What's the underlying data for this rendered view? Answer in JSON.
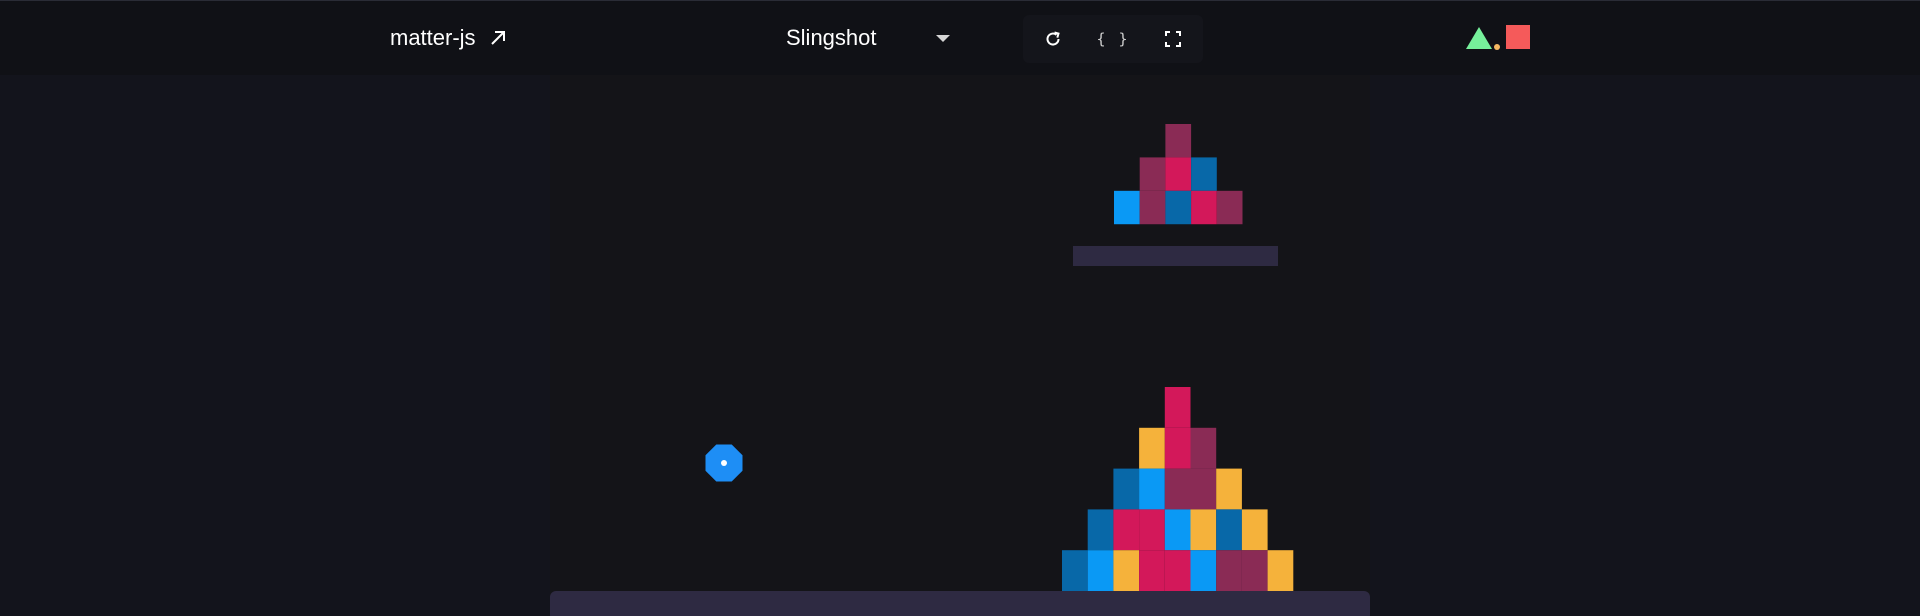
{
  "topbar": {
    "brand_label": "matter-js",
    "brand_link_icon": "external-link-arrow-icon",
    "demo_select": {
      "selected": "Slingshot"
    },
    "tools": [
      {
        "name": "reset-button",
        "icon": "reset-icon"
      },
      {
        "name": "source-code-button",
        "icon": "braces-icon",
        "label": "{ }"
      },
      {
        "name": "fullscreen-button",
        "icon": "fullscreen-icon"
      }
    ],
    "logo": {
      "triangle_color": "#76f09b",
      "dot_color": "#f5b862",
      "square_color": "#f55a5a"
    }
  },
  "scene": {
    "colors": {
      "background": "#141418",
      "ground": "#2e2a42",
      "platform": "#2e2a42",
      "rock": "#1e8ef5",
      "crimson": "#d3185a",
      "plum": "#8a2b55",
      "blue": "#0a99f5",
      "teal": "#0868a8",
      "amber": "#f5b23b"
    }
  }
}
